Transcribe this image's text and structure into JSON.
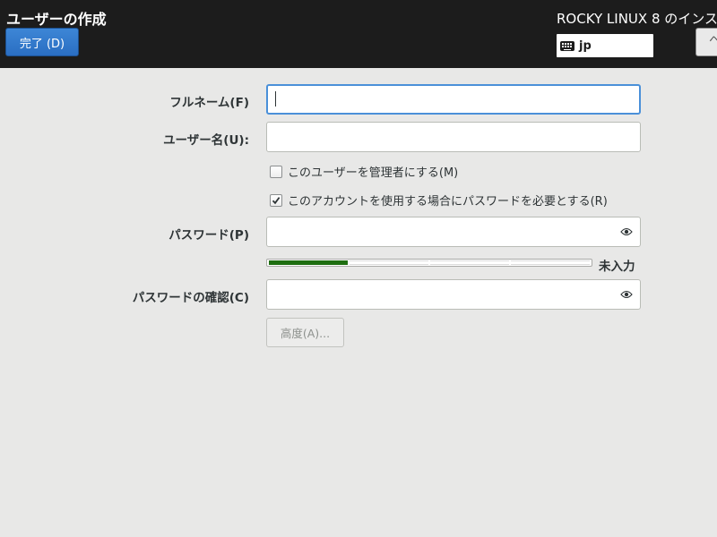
{
  "header": {
    "title": "ユーザーの作成",
    "done_button": "完了 (D)",
    "product_title": "ROCKY LINUX 8 のインス",
    "keyboard_layout": "jp",
    "help_button": "ヘ"
  },
  "form": {
    "fullname": {
      "label": "フルネーム(F)",
      "value": ""
    },
    "username": {
      "label": "ユーザー名(U):",
      "value": ""
    },
    "admin_checkbox": {
      "label": "このユーザーを管理者にする(M)",
      "checked": false
    },
    "require_password_checkbox": {
      "label": "このアカウントを使用する場合にパスワードを必要とする(R)",
      "checked": true
    },
    "password": {
      "label": "パスワード(P)",
      "value": ""
    },
    "password_strength": {
      "text": "未入力",
      "filled_segments": 1,
      "total_segments": 4
    },
    "confirm_password": {
      "label": "パスワードの確認(C)",
      "value": ""
    },
    "advanced_button": "高度(A)..."
  },
  "colors": {
    "header_bg": "#1c1c1c",
    "accent": "#4a90d9",
    "strength_fill": "#1e6e11",
    "page_bg": "#e8e8e7"
  },
  "icons": [
    "keyboard-icon",
    "eye-icon",
    "checkmark-icon"
  ]
}
